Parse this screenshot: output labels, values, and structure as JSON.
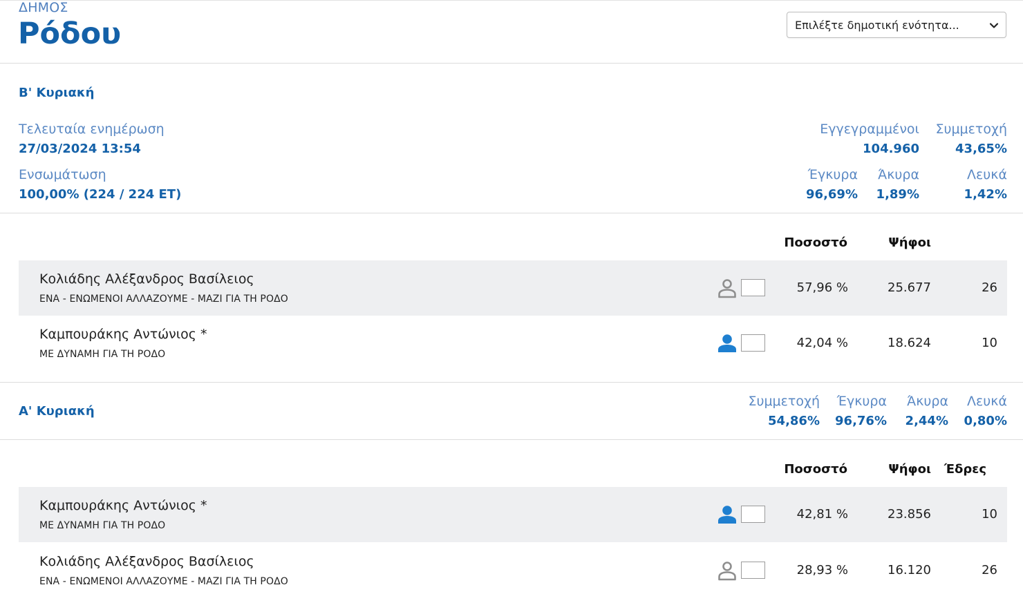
{
  "header": {
    "kicker": "ΔΗΜΟΣ",
    "municipality": "Ρόδου",
    "unit_select": "Επιλέξτε δημοτική ενότητα..."
  },
  "round_b": {
    "title": "Β' Κυριακή",
    "last_update_label": "Τελευταία ενημέρωση",
    "last_update_value": "27/03/2024 13:54",
    "integration_label": "Ενσωμάτωση",
    "integration_value": "100,00% (224 / 224 ΕΤ)",
    "registered_label": "Εγγεγραμμένοι",
    "registered_value": "104.960",
    "turnout_label": "Συμμετοχή",
    "turnout_value": "43,65%",
    "valid_label": "Έγκυρα",
    "valid_value": "96,69%",
    "invalid_label": "Άκυρα",
    "invalid_value": "1,89%",
    "blank_label": "Λευκά",
    "blank_value": "1,42%",
    "col_pct": "Ποσοστό",
    "col_votes": "Ψήφοι",
    "rows": [
      {
        "name": "Κολιάδης Αλέξανδρος Βασίλειος",
        "party": "ΕΝΑ - ΕΝΩΜΕΝΟΙ ΑΛΛΑΖΟΥΜΕ - ΜΑΖΙ ΓΙΑ ΤΗ ΡΟΔΟ",
        "pct": "57,96 %",
        "votes": "25.677",
        "seats": "26",
        "winner": false
      },
      {
        "name": "Καμπουράκης Αντώνιος *",
        "party": "ΜΕ ΔΥΝΑΜΗ ΓΙΑ ΤΗ ΡΟΔΟ",
        "pct": "42,04 %",
        "votes": "18.624",
        "seats": "10",
        "winner": true
      }
    ]
  },
  "round_a": {
    "title": "Α' Κυριακή",
    "turnout_label": "Συμμετοχή",
    "turnout_value": "54,86%",
    "valid_label": "Έγκυρα",
    "valid_value": "96,76%",
    "invalid_label": "Άκυρα",
    "invalid_value": "2,44%",
    "blank_label": "Λευκά",
    "blank_value": "0,80%",
    "col_pct": "Ποσοστό",
    "col_votes": "Ψήφοι",
    "col_seats": "Έδρες",
    "rows": [
      {
        "name": "Καμπουράκης Αντώνιος *",
        "party": "ΜΕ ΔΥΝΑΜΗ ΓΙΑ ΤΗ ΡΟΔΟ",
        "pct": "42,81 %",
        "votes": "23.856",
        "seats": "10",
        "winner": true
      },
      {
        "name": "Κολιάδης Αλέξανδρος Βασίλειος",
        "party": "ΕΝΑ - ΕΝΩΜΕΝΟΙ ΑΛΛΑΖΟΥΜΕ - ΜΑΖΙ ΓΙΑ ΤΗ ΡΟΔΟ",
        "pct": "28,93 %",
        "votes": "16.120",
        "seats": "26",
        "winner": false
      }
    ]
  },
  "colors": {
    "brand_blue": "#1461a8",
    "soft_blue": "#5b89c4",
    "person_active": "#1e7fd0",
    "person_inactive": "#8e8e8e",
    "row_shade": "#eeeff1"
  }
}
